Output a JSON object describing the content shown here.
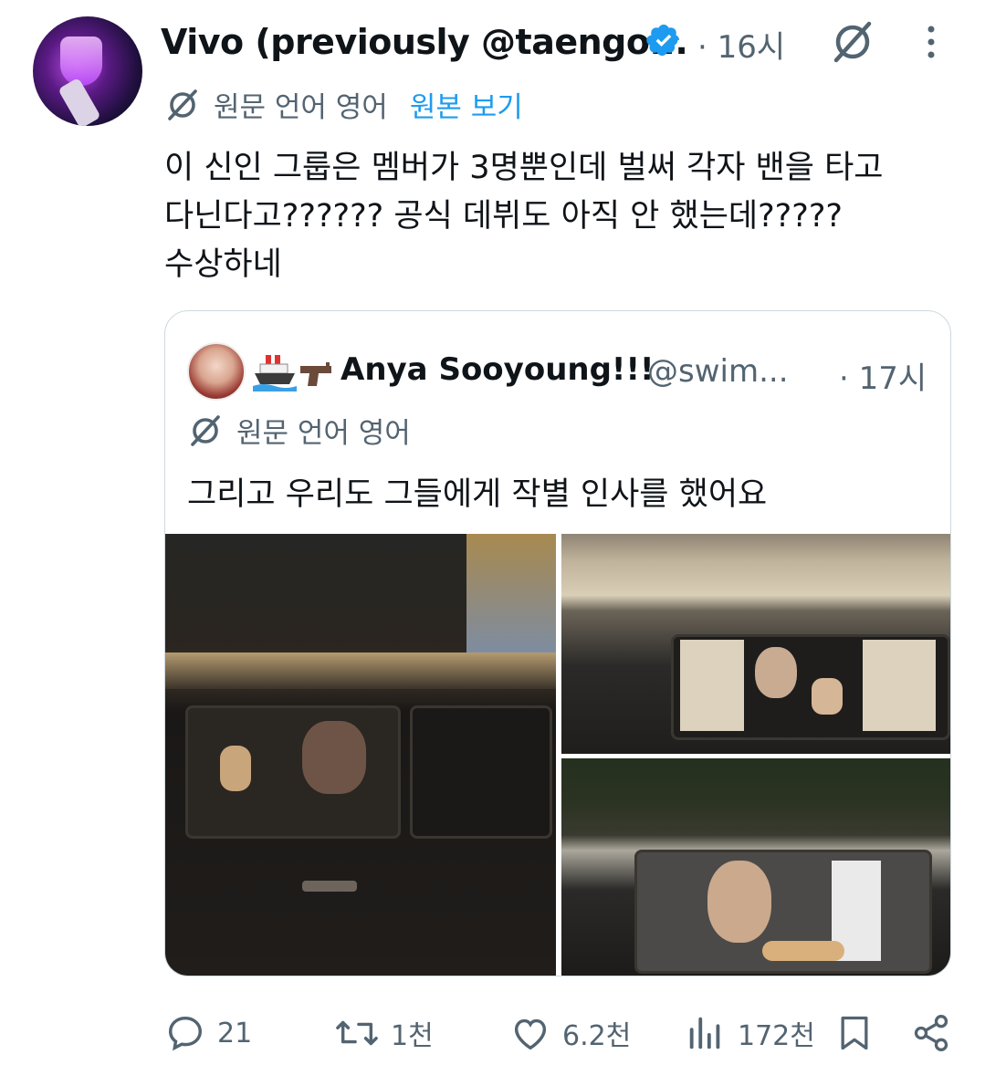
{
  "tweet": {
    "author_name": "Vivo (previously @taengo...",
    "verified": true,
    "time": "· 16시",
    "translation_note": "원문 언어 영어",
    "view_original": "원본 보기",
    "text_lines": [
      "이 신인 그룹은 멤버가 3명뿐인데 벌써 각자 밴을 타고",
      "다닌다고?????? 공식 데뷔도 아직 안 했는데?????",
      "수상하네"
    ]
  },
  "quoted": {
    "emoji": [
      "🚢",
      "🔫"
    ],
    "author_name": "Anya Sooyoung!!!",
    "handle": "@swim...",
    "time": "· 17시",
    "translation_note": "원문 언어 영어",
    "text": "그리고 우리도 그들에게 작별 인사를 했어요",
    "media_count": 3
  },
  "actions": {
    "replies": "21",
    "reposts": "1천",
    "likes": "6.2천",
    "views": "172천"
  },
  "colors": {
    "text": "#0f1419",
    "secondary": "#536471",
    "link": "#1d9bf0",
    "border": "#cfd9de"
  },
  "icons": [
    "verified-badge-icon",
    "grok-icon",
    "more-icon",
    "translate-icon",
    "reply-icon",
    "repost-icon",
    "like-icon",
    "views-icon",
    "bookmark-icon",
    "share-icon"
  ]
}
